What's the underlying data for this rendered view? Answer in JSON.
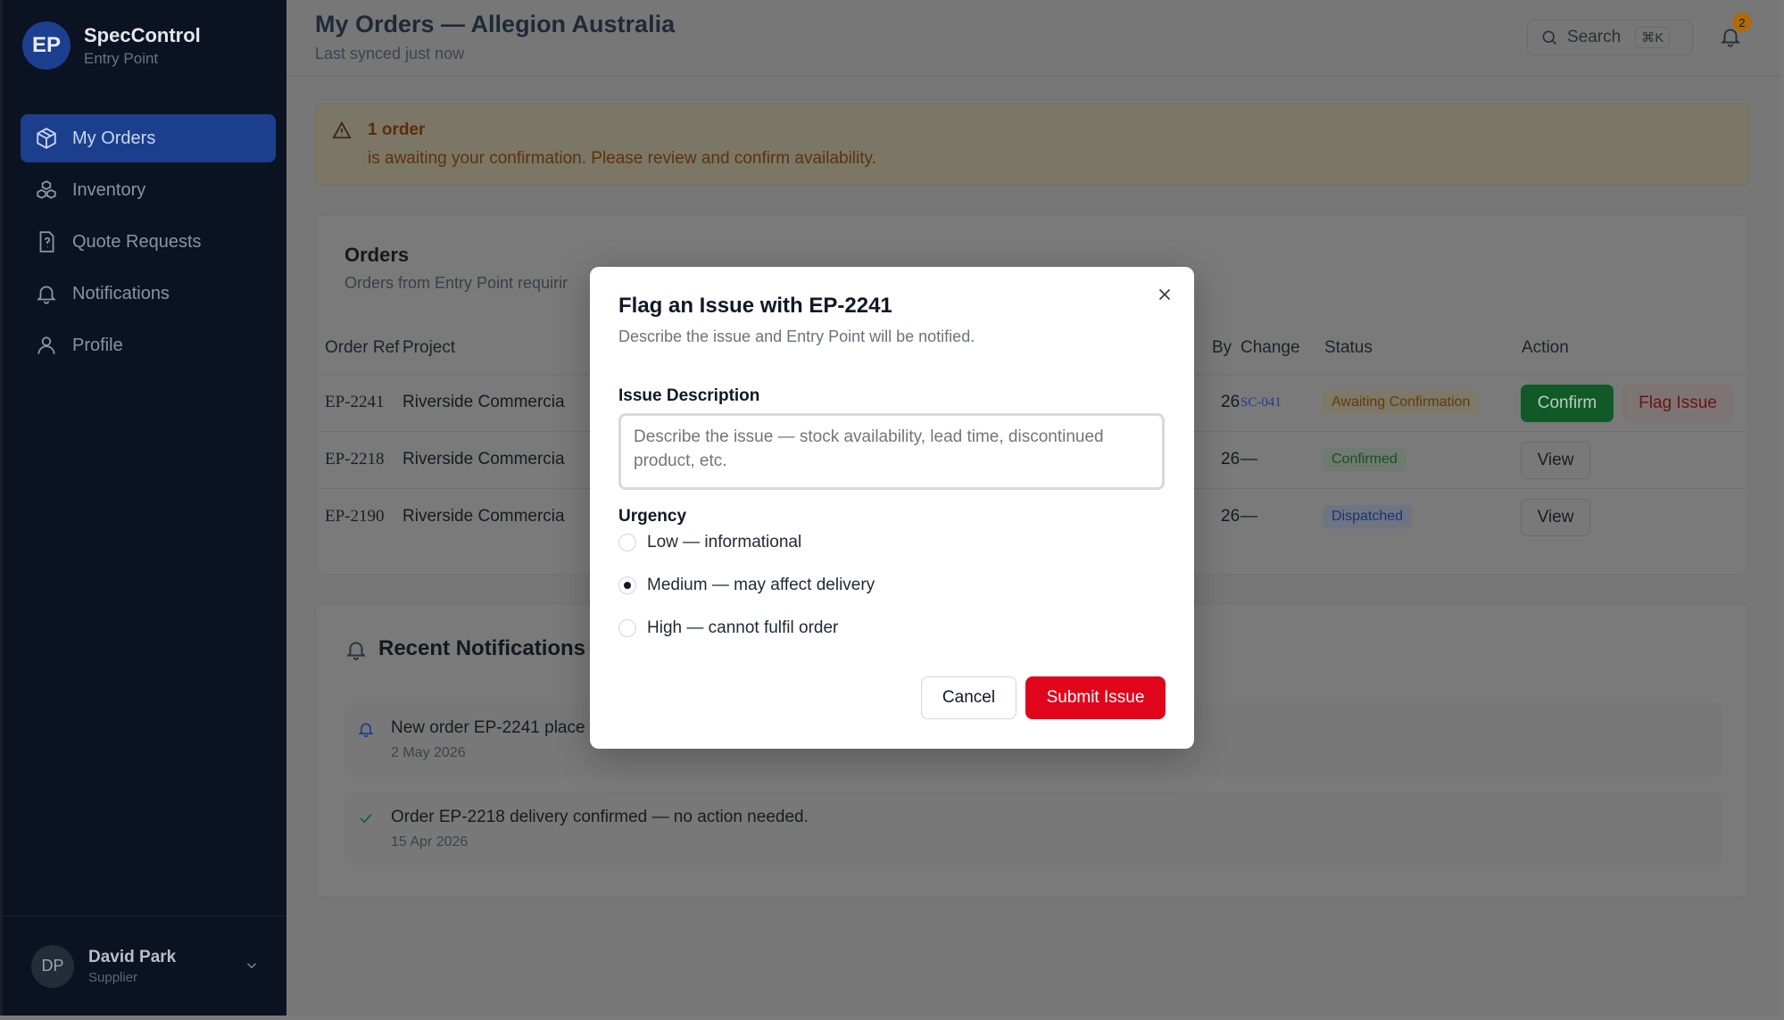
{
  "brand": {
    "initials": "EP",
    "title": "SpecControl",
    "subtitle": "Entry Point"
  },
  "nav": [
    {
      "label": "My Orders",
      "icon": "package-icon",
      "active": true
    },
    {
      "label": "Inventory",
      "icon": "boxes-icon"
    },
    {
      "label": "Quote Requests",
      "icon": "quote-doc-icon"
    },
    {
      "label": "Notifications",
      "icon": "bell-icon"
    },
    {
      "label": "Profile",
      "icon": "user-icon"
    }
  ],
  "user": {
    "initials": "DP",
    "name": "David Park",
    "role": "Supplier"
  },
  "header": {
    "title": "My Orders — Allegion Australia",
    "subtitle": "Last synced just now",
    "search_label": "Search",
    "search_shortcut": "⌘K",
    "notification_count": "2"
  },
  "alert": {
    "title": "1 order",
    "text": "is awaiting your confirmation. Please review and confirm availability."
  },
  "orders": {
    "title": "Orders",
    "subtitle": "Orders from Entry Point requirir",
    "columns": {
      "ref": "Order Ref",
      "project": "Project",
      "by": "By",
      "change": "Change",
      "status": "Status",
      "action": "Action"
    },
    "rows": [
      {
        "ref": "EP-2241",
        "project": "Riverside Commercia",
        "by": "26",
        "change": "SC-041",
        "status": "Awaiting Confirmation",
        "action1": "Confirm",
        "action2": "Flag Issue"
      },
      {
        "ref": "EP-2218",
        "project": "Riverside Commercia",
        "by": "26",
        "change": "—",
        "status": "Confirmed",
        "action1": "View"
      },
      {
        "ref": "EP-2190",
        "project": "Riverside Commercia",
        "by": "26",
        "change": "—",
        "status": "Dispatched",
        "action1": "View"
      }
    ]
  },
  "notifications": {
    "title": "Recent Notifications",
    "items": [
      {
        "text": "New order EP-2241 place",
        "date": "2 May 2026",
        "icon": "bell-icon"
      },
      {
        "text": "Order EP-2218 delivery confirmed — no action needed.",
        "date": "15 Apr 2026",
        "icon": "check-icon"
      }
    ]
  },
  "modal": {
    "title": "Flag an Issue with EP-2241",
    "subtitle": "Describe the issue and Entry Point will be notified.",
    "description_label": "Issue Description",
    "description_placeholder": "Describe the issue — stock availability, lead time, discontinued product, etc.",
    "urgency_label": "Urgency",
    "urgency_options": [
      "Low — informational",
      "Medium — may affect delivery",
      "High — cannot fulfil order"
    ],
    "urgency_selected": "Medium — may affect delivery",
    "cancel_label": "Cancel",
    "submit_label": "Submit Issue"
  },
  "colors": {
    "accent": "#1c3f8d",
    "danger": "#e0051b",
    "success": "#115a28",
    "sidebar": "#0b1222"
  }
}
